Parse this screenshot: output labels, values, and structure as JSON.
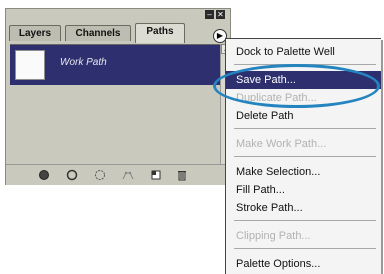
{
  "panel": {
    "tabs": [
      {
        "label": "Layers"
      },
      {
        "label": "Channels"
      },
      {
        "label": "Paths"
      }
    ],
    "path_item": {
      "name": "Work Path"
    },
    "window_buttons": {
      "minimize": "–",
      "close": "✕"
    },
    "menu_arrow_glyph": "▶",
    "bottom_icons": [
      "fill-path-icon",
      "stroke-path-icon",
      "load-selection-icon",
      "make-work-path-icon",
      "new-path-icon",
      "trash-icon"
    ]
  },
  "menu": {
    "items": [
      {
        "label": "Dock to Palette Well",
        "disabled": false
      },
      {
        "label": "Save Path...",
        "disabled": false,
        "selected": true
      },
      {
        "label": "Duplicate Path...",
        "disabled": true
      },
      {
        "label": "Delete Path",
        "disabled": false
      },
      {
        "label": "Make Work Path...",
        "disabled": true
      },
      {
        "label": "Make Selection...",
        "disabled": false
      },
      {
        "label": "Fill Path...",
        "disabled": false
      },
      {
        "label": "Stroke Path...",
        "disabled": false
      },
      {
        "label": "Clipping Path...",
        "disabled": true
      },
      {
        "label": "Palette Options...",
        "disabled": false
      }
    ]
  },
  "colors": {
    "selection": "#2e2f6f",
    "highlight_ring": "#2484c0",
    "panel_bg": "#c9c9bd"
  }
}
